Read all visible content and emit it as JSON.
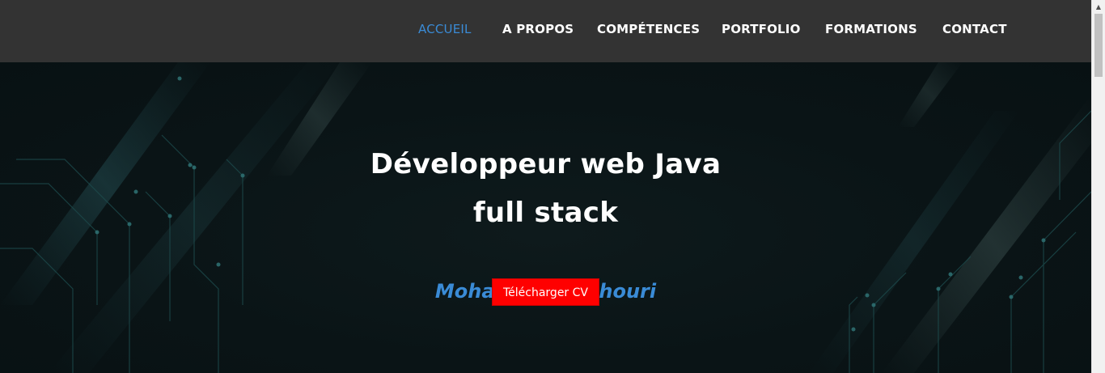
{
  "nav": {
    "items": [
      {
        "label": "ACCUEIL",
        "active": true
      },
      {
        "label": "A PROPOS",
        "active": false
      },
      {
        "label": "COMPÉTENCES",
        "active": false
      },
      {
        "label": "PORTFOLIO",
        "active": false
      },
      {
        "label": "FORMATIONS",
        "active": false
      },
      {
        "label": "CONTACT",
        "active": false
      }
    ]
  },
  "hero": {
    "title_line1": "Développeur web Java",
    "title_line2": "full stack",
    "name": "Mohamed Leachouri",
    "cv_button_label": "Télécharger CV"
  },
  "colors": {
    "navbar_bg": "#333333",
    "accent_blue": "#3a8bd6",
    "button_red": "#ff0000",
    "hero_bg": "#0a1416"
  }
}
